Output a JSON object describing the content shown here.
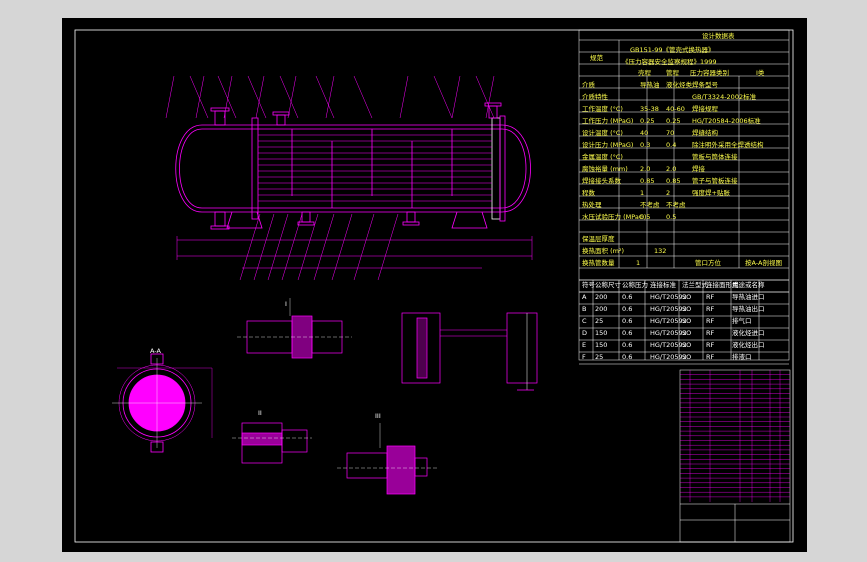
{
  "title_block": {
    "heading": "设计数据表",
    "spec_label": "规范",
    "spec_line1": "GB151-99《管壳式换热器》",
    "spec_line2": "《压力容器安全监察规程》1999",
    "col_shell": "壳程",
    "col_tube": "管程",
    "col_vessel": "压力容器类别",
    "vessel_class": "I类"
  },
  "design_rows": [
    {
      "label": "介质",
      "shell": "导热油",
      "tube": "液化烃类"
    },
    {
      "label": "介质特性",
      "shell": "",
      "tube": ""
    },
    {
      "label": "工作温度 (°C)",
      "shell": "35-38",
      "tube": "40-60"
    },
    {
      "label": "工作压力 (MPaG)",
      "shell": "0.25",
      "tube": "0.25"
    },
    {
      "label": "设计温度 (°C)",
      "shell": "40",
      "tube": "70"
    },
    {
      "label": "设计压力 (MPaG)",
      "shell": "0.3",
      "tube": "0.4"
    },
    {
      "label": "金属温度 (°C)",
      "shell": "",
      "tube": ""
    },
    {
      "label": "腐蚀裕量 (mm)",
      "shell": "2.0",
      "tube": "2.0"
    },
    {
      "label": "焊接接头系数",
      "shell": "0.85",
      "tube": "0.85"
    },
    {
      "label": "程数",
      "shell": "1",
      "tube": "2"
    },
    {
      "label": "热处理",
      "shell": "不考虑",
      "tube": "不考虑"
    },
    {
      "label": "水压试验压力 (MPaG)",
      "shell": "0.5",
      "tube": "0.5"
    }
  ],
  "right_rows": [
    "焊条型号",
    "GB/T3324-2002标准",
    "焊接规程",
    "HG/T20584-2006标准",
    "焊缝结构",
    "除注明外采用全焊透结构",
    "管板与筒体连接",
    "焊接",
    "管子与管板连接",
    "强度焊+贴胀"
  ],
  "bottom_rows": {
    "insulation_label": "保温层厚度",
    "area_label": "换热面积 (m²)",
    "area_value": "132",
    "nozzle_label": "管口方位",
    "nozzle_value": "按A-A剖视图",
    "count_label": "换热管数量",
    "count_value": "1"
  },
  "nozzle_table": {
    "headers": [
      "符号",
      "公称尺寸",
      "公称压力",
      "连接标准",
      "法兰型式",
      "连接面形式",
      "用途或名称"
    ],
    "rows": [
      [
        "A",
        "200",
        "0.6",
        "HG/T20592",
        "SO",
        "RF",
        "导热油进口"
      ],
      [
        "B",
        "200",
        "0.6",
        "HG/T20592",
        "SO",
        "RF",
        "导热油出口"
      ],
      [
        "C",
        "25",
        "0.6",
        "HG/T20592",
        "SO",
        "RF",
        "排气口"
      ],
      [
        "D",
        "150",
        "0.6",
        "HG/T20592",
        "SO",
        "RF",
        "液化烃进口"
      ],
      [
        "E",
        "150",
        "0.6",
        "HG/T20592",
        "SO",
        "RF",
        "液化烃出口"
      ],
      [
        "F",
        "25",
        "0.6",
        "HG/T20592",
        "SO",
        "RF",
        "排液口"
      ]
    ]
  },
  "views": {
    "section_aa": "A-A",
    "detail_1": "I",
    "detail_2": "II",
    "detail_3": "III"
  },
  "colors": {
    "sheet": "#000000",
    "frame": "#ffffff",
    "drawing": "#ff00ff",
    "text": "#ffffff",
    "hatch": "#ff00ff"
  }
}
